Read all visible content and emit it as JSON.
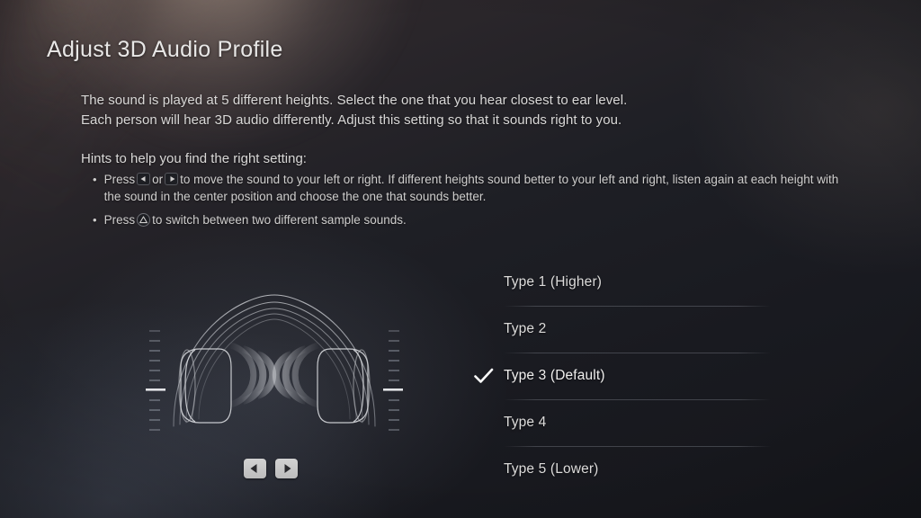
{
  "header": {
    "title": "Adjust 3D Audio Profile"
  },
  "description": {
    "line1": "The sound is played at 5 different heights. Select the one that you hear closest to ear level.",
    "line2": "Each person will hear 3D audio differently. Adjust this setting so that it sounds right to you."
  },
  "hints": {
    "title": "Hints to help you find the right setting:",
    "bullet_marker": "•",
    "items": [
      {
        "prefix": "Press",
        "glyph_1": "dpad-left-icon",
        "conjunction": "or",
        "glyph_2": "dpad-right-icon",
        "suffix": "to move the sound to your left or right. If different heights sound better to your left and right, listen again at each height with the sound in the center position and choose the one that sounds better."
      },
      {
        "prefix": "Press",
        "glyph_1": "triangle-button-icon",
        "suffix": "to switch between two different sample sounds."
      }
    ]
  },
  "illustration": {
    "name": "headphones-3d-audio-illustration",
    "left_scale": "height-scale-left",
    "right_scale": "height-scale-right",
    "selected_tick_index": 2,
    "tick_count": 11
  },
  "controls": {
    "left_button": "dpad-left-button",
    "right_button": "dpad-right-button"
  },
  "options": {
    "selected_index": 2,
    "check_icon": "checkmark-icon",
    "items": [
      {
        "label": "Type 1 (Higher)"
      },
      {
        "label": "Type 2"
      },
      {
        "label": "Type 3 (Default)"
      },
      {
        "label": "Type 4"
      },
      {
        "label": "Type 5 (Lower)"
      }
    ]
  },
  "colors": {
    "background_dark": "#15161b",
    "background_warm": "#3a3133",
    "text_primary": "#e8e7e6",
    "text_secondary": "#cfcecd",
    "accent_white": "#ffffff",
    "divider": "#a0a5af",
    "button_face": "#d2d2d2"
  }
}
